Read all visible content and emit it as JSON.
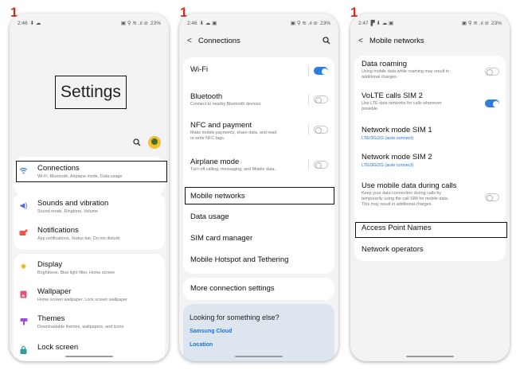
{
  "step_label": "1",
  "status": {
    "time_1": "2:46",
    "time_2": "2:46",
    "time_3": "2:47",
    "battery": "23%"
  },
  "phone1": {
    "title": "Settings",
    "items": [
      {
        "title": "Connections",
        "sub": "Wi-Fi, Bluetooth, Airplane mode, Data usage"
      },
      {
        "title": "Sounds and vibration",
        "sub": "Sound mode, Ringtone, Volume"
      },
      {
        "title": "Notifications",
        "sub": "App notifications, Status bar, Do not disturb"
      },
      {
        "title": "Display",
        "sub": "Brightness, Blue light filter, Home screen"
      },
      {
        "title": "Wallpaper",
        "sub": "Home screen wallpaper, Lock screen wallpaper"
      },
      {
        "title": "Themes",
        "sub": "Downloadable themes, wallpapers, and icons"
      },
      {
        "title": "Lock screen",
        "sub": ""
      }
    ]
  },
  "phone2": {
    "title": "Connections",
    "items": [
      {
        "title": "Wi-Fi",
        "sub": ""
      },
      {
        "title": "Bluetooth",
        "sub": "Connect to nearby Bluetooth devices."
      },
      {
        "title": "NFC and payment",
        "sub_1": "Make mobile payments, share data, and read",
        "sub_2": "or write NFC tags."
      },
      {
        "title": "Airplane mode",
        "sub": "Turn off calling, messaging, and Mobile data."
      },
      {
        "title": "Mobile networks"
      },
      {
        "title": "Data usage"
      },
      {
        "title": "SIM card manager"
      },
      {
        "title": "Mobile Hotspot and Tethering"
      },
      {
        "title": "More connection settings"
      }
    ],
    "look": {
      "title": "Looking for something else?",
      "link1": "Samsung Cloud",
      "link2": "Location"
    }
  },
  "phone3": {
    "title": "Mobile networks",
    "items": [
      {
        "title": "Data roaming",
        "sub_1": "Using mobile data while roaming may result in",
        "sub_2": "additional charges."
      },
      {
        "title": "VoLTE calls SIM 2",
        "sub_1": "Use LTE data networks for calls whenever",
        "sub_2": "possible."
      },
      {
        "title": "Network mode SIM 1",
        "sub": "LTE/3G/2G (auto connect)"
      },
      {
        "title": "Network mode SIM 2",
        "sub": "LTE/3G/2G (auto connect)"
      },
      {
        "title": "Use mobile data during calls",
        "sub_1": "Keep your data connection during calls by",
        "sub_2": "temporarily using the call SIM for mobile data.",
        "sub_3": "This may result in additional charges."
      },
      {
        "title": "Access Point Names"
      },
      {
        "title": "Network operators"
      }
    ]
  },
  "colors": {
    "accent": "#2f7de1",
    "step_label": "#d62b1e",
    "link": "#1a73e8"
  },
  "icons": [
    "wifi-icon",
    "volume-icon",
    "notification-icon",
    "brightness-icon",
    "wallpaper-icon",
    "themes-icon",
    "lock-icon",
    "search-icon",
    "back-icon",
    "avatar"
  ]
}
